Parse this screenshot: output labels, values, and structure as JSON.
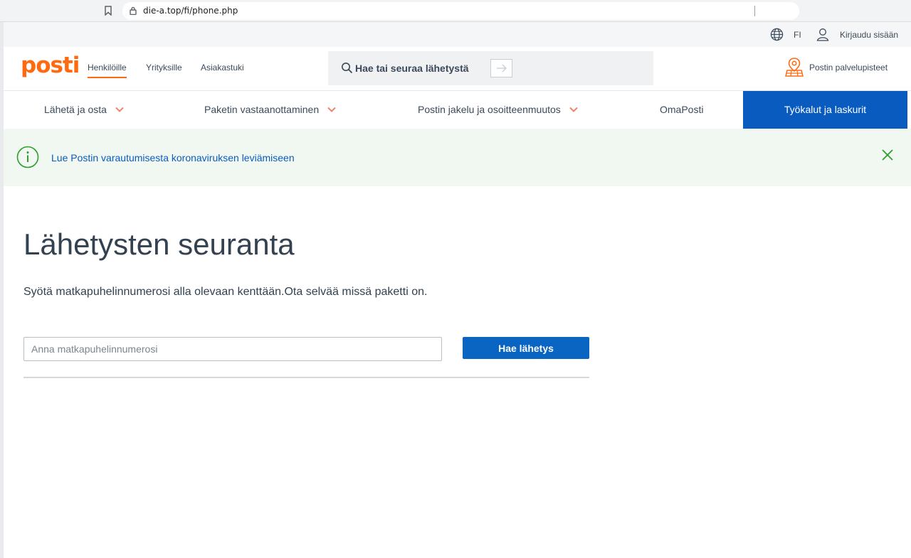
{
  "browser": {
    "url": "die-a.top/fi/phone.php",
    "icons": {
      "bookmark": "bookmark-icon",
      "lock": "lock-icon"
    }
  },
  "utility_bar": {
    "language": "FI",
    "login_label": "Kirjaudu sisään",
    "icons": {
      "language": "globe-icon",
      "login": "user-icon"
    }
  },
  "header": {
    "logo_text": "posti",
    "nav": [
      {
        "label": "Henkilöille",
        "active": true
      },
      {
        "label": "Yrityksille",
        "active": false
      },
      {
        "label": "Asiakastuki",
        "active": false
      }
    ],
    "search_label": "Hae tai seuraa lähetystä",
    "service_points_label": "Postin palvelupisteet",
    "colors": {
      "brand": "#ff6a10",
      "primary": "#0a5bbf"
    }
  },
  "category_nav": {
    "items": [
      {
        "label": "Lähetä ja osta",
        "has_dropdown": true
      },
      {
        "label": "Paketin vastaanottaminen",
        "has_dropdown": true
      },
      {
        "label": "Postin jakelu ja osoitteenmuutos",
        "has_dropdown": true
      },
      {
        "label": "OmaPosti",
        "has_dropdown": false
      },
      {
        "label": "Työkalut ja laskurit",
        "has_dropdown": false,
        "active": true
      }
    ]
  },
  "notice": {
    "link_text": "Lue Postin varautumisesta koronaviruksen leviämiseen",
    "background": "#f1f8f1",
    "accent": "#2e9e2e"
  },
  "main": {
    "title": "Lähetysten seuranta",
    "description": "Syötä matkapuhelinnumerosi alla olevaan kenttään.Ota selvää missä paketti on.",
    "phone_input": {
      "placeholder": "Anna matkapuhelinnumerosi",
      "value": ""
    },
    "submit_label": "Hae lähetys"
  }
}
